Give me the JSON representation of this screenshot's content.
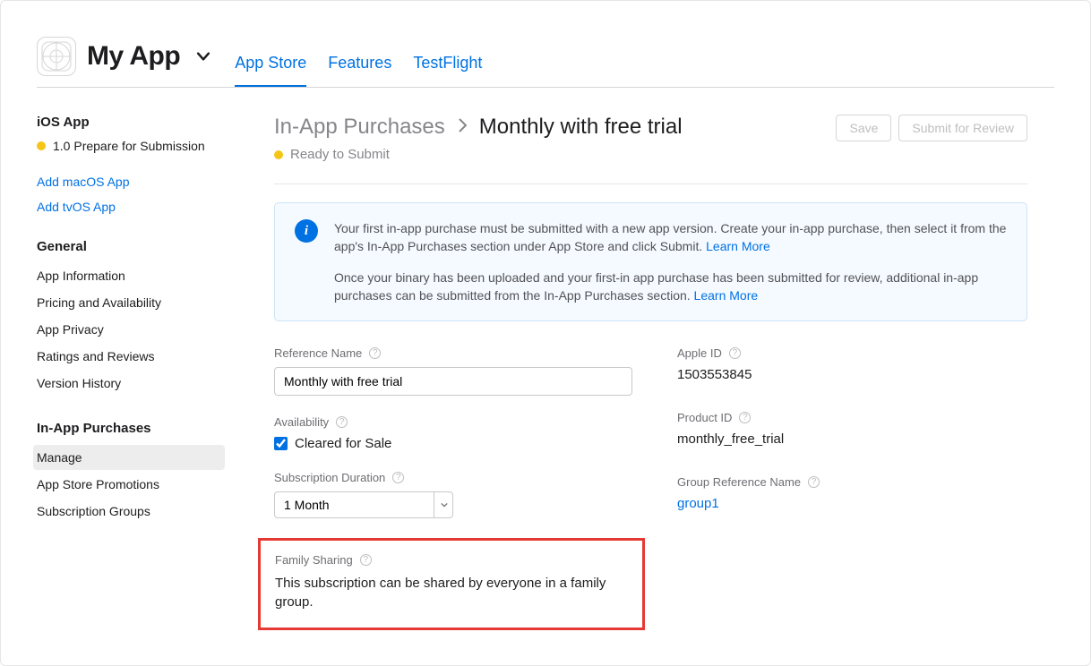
{
  "header": {
    "app_name": "My App",
    "tabs": {
      "app_store": "App Store",
      "features": "Features",
      "testflight": "TestFlight"
    }
  },
  "sidebar": {
    "platform_heading": "iOS App",
    "version_line": "1.0 Prepare for Submission",
    "add_macos": "Add macOS App",
    "add_tvos": "Add tvOS App",
    "general_heading": "General",
    "general_items": {
      "app_info": "App Information",
      "pricing": "Pricing and Availability",
      "privacy": "App Privacy",
      "ratings": "Ratings and Reviews",
      "history": "Version History"
    },
    "iap_heading": "In-App Purchases",
    "iap_items": {
      "manage": "Manage",
      "promotions": "App Store Promotions",
      "groups": "Subscription Groups"
    }
  },
  "main": {
    "crumb_parent": "In-App Purchases",
    "crumb_current": "Monthly with free trial",
    "status": "Ready to Submit",
    "buttons": {
      "save": "Save",
      "submit": "Submit for Review"
    },
    "banner": {
      "p1a": "Your first in-app purchase must be submitted with a new app version. Create your in-app purchase, then select it from the app's In-App Purchases section under App Store and click Submit. ",
      "learn_more": "Learn More",
      "p2a": "Once your binary has been uploaded and your first-in app purchase has been submitted for review, additional in-app purchases can be submitted from the In-App Purchases section. "
    },
    "fields": {
      "ref_name_label": "Reference Name",
      "ref_name_value": "Monthly with free trial",
      "availability_label": "Availability",
      "cleared_label": "Cleared for Sale",
      "cleared_checked": true,
      "duration_label": "Subscription Duration",
      "duration_value": "1 Month",
      "family_label": "Family Sharing",
      "family_desc": "This subscription can be shared by everyone in a family group.",
      "apple_id_label": "Apple ID",
      "apple_id_value": "1503553845",
      "product_id_label": "Product ID",
      "product_id_value": "monthly_free_trial",
      "group_label": "Group Reference Name",
      "group_value": "group1"
    }
  }
}
